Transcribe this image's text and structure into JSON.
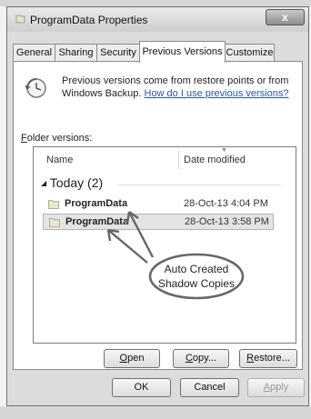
{
  "window": {
    "title": "ProgramData Properties",
    "close_label": "x"
  },
  "tabs": [
    {
      "label": "General",
      "active": false
    },
    {
      "label": "Sharing",
      "active": false
    },
    {
      "label": "Security",
      "active": false
    },
    {
      "label": "Previous Versions",
      "active": true
    },
    {
      "label": "Customize",
      "active": false
    }
  ],
  "description": {
    "line1": "Previous versions come from restore points or from",
    "line2_text": "Windows Backup.",
    "link": "How do I use previous versions?"
  },
  "folder_versions_label": {
    "accel": "F",
    "rest": "older versions:"
  },
  "list": {
    "headers": {
      "name": "Name",
      "date": "Date modified"
    },
    "group": "Today (2)",
    "group_toggle": "◢",
    "rows": [
      {
        "name": "ProgramData",
        "date": "28-Oct-13 4:04 PM",
        "selected": false
      },
      {
        "name": "ProgramData",
        "date": "28-Oct-13 3:58 PM",
        "selected": true
      }
    ]
  },
  "annotation": {
    "line1": "Auto Created",
    "line2": "Shadow Copies"
  },
  "panel_buttons": {
    "open": {
      "accel": "O",
      "rest": "pen"
    },
    "copy": {
      "accel": "C",
      "rest": "opy..."
    },
    "restore": {
      "accel": "R",
      "rest": "estore..."
    }
  },
  "dialog_buttons": {
    "ok": "OK",
    "cancel": "Cancel",
    "apply": {
      "accel": "A",
      "rest": "pply"
    }
  },
  "colors": {
    "link": "#2a55a8",
    "annotation_stroke": "#666666"
  }
}
